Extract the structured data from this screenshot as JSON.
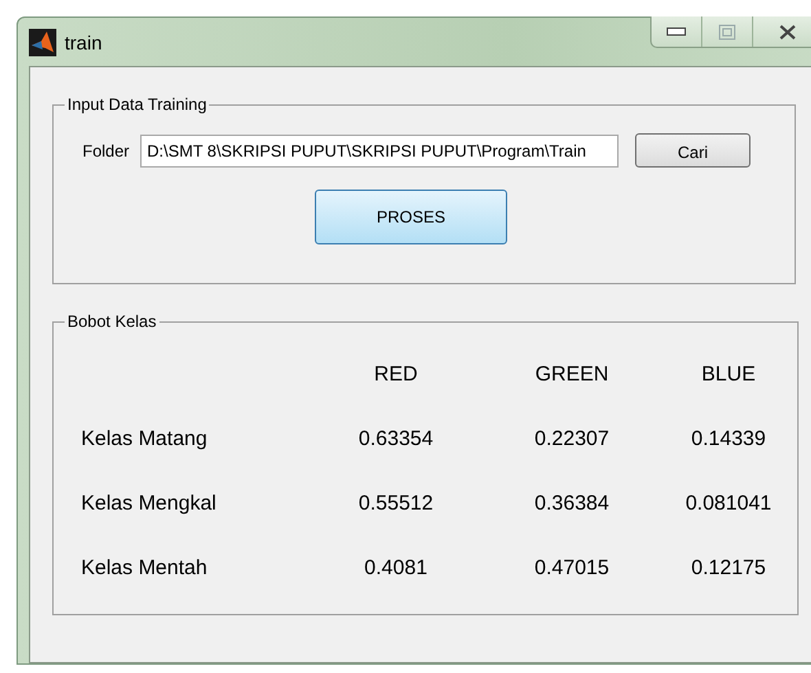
{
  "window": {
    "title": "train"
  },
  "input_panel": {
    "title": "Input Data Training",
    "folder_label": "Folder",
    "folder_value": "D:\\SMT 8\\SKRIPSI PUPUT\\SKRIPSI PUPUT\\Program\\Train",
    "browse_button": "Cari",
    "process_button": "PROSES"
  },
  "weights_panel": {
    "title": "Bobot Kelas",
    "columns": [
      "RED",
      "GREEN",
      "BLUE"
    ],
    "rows": [
      {
        "label": "Kelas Matang",
        "values": [
          "0.63354",
          "0.22307",
          "0.14339"
        ]
      },
      {
        "label": "Kelas Mengkal",
        "values": [
          "0.55512",
          "0.36384",
          "0.081041"
        ]
      },
      {
        "label": "Kelas Mentah",
        "values": [
          "0.4081",
          "0.47015",
          "0.12175"
        ]
      }
    ]
  }
}
